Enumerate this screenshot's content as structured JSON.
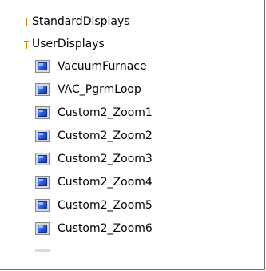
{
  "tree": {
    "folders": [
      {
        "label": "StandardDisplays",
        "state": "collapsed",
        "icon": "folder-collapsed-icon"
      },
      {
        "label": "UserDisplays",
        "state": "expanded",
        "icon": "folder-expanded-icon"
      }
    ],
    "displays": [
      {
        "label": "VacuumFurnace",
        "icon": "display-icon"
      },
      {
        "label": "VAC_PgrmLoop",
        "icon": "display-icon"
      },
      {
        "label": "Custom2_Zoom1",
        "icon": "display-icon"
      },
      {
        "label": "Custom2_Zoom2",
        "icon": "display-icon"
      },
      {
        "label": "Custom2_Zoom3",
        "icon": "display-icon"
      },
      {
        "label": "Custom2_Zoom4",
        "icon": "display-icon"
      },
      {
        "label": "Custom2_Zoom5",
        "icon": "display-icon"
      },
      {
        "label": "Custom2_Zoom6",
        "icon": "display-icon"
      }
    ]
  },
  "colors": {
    "folder_icon": "#e08a00",
    "display_screen": "#2b63e6",
    "panel_border": "#6f6f6f"
  }
}
